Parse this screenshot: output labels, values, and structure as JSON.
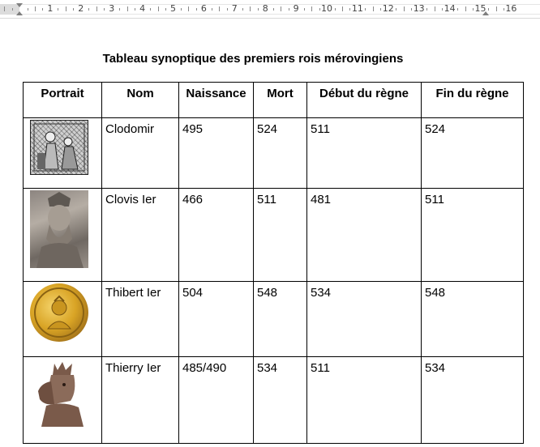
{
  "ruler": {
    "numbers": [
      "1",
      "2",
      "3",
      "4",
      "5",
      "6",
      "7",
      "8",
      "9",
      "10",
      "11",
      "12",
      "13",
      "14",
      "15",
      "16"
    ]
  },
  "document": {
    "title": "Tableau synoptique des premiers rois mérovingiens",
    "columns": [
      "Portrait",
      "Nom",
      "Naissance",
      "Mort",
      "Début du règne",
      "Fin du règne"
    ],
    "rows": [
      {
        "portrait_icon": "manuscript-miniature-image",
        "name": "Clodomir",
        "birth": "495",
        "death": "524",
        "reign_start": "511",
        "reign_end": "524"
      },
      {
        "portrait_icon": "stone-statue-image",
        "name": "Clovis Ier",
        "birth": "466",
        "death": "511",
        "reign_start": "481",
        "reign_end": "511"
      },
      {
        "portrait_icon": "gold-coin-image",
        "name": "Thibert Ier",
        "birth": "504",
        "death": "548",
        "reign_start": "534",
        "reign_end": "548"
      },
      {
        "portrait_icon": "crowned-king-engraving-image",
        "name": "Thierry Ier",
        "birth": "485/490",
        "death": "534",
        "reign_start": "511",
        "reign_end": "534"
      }
    ]
  }
}
